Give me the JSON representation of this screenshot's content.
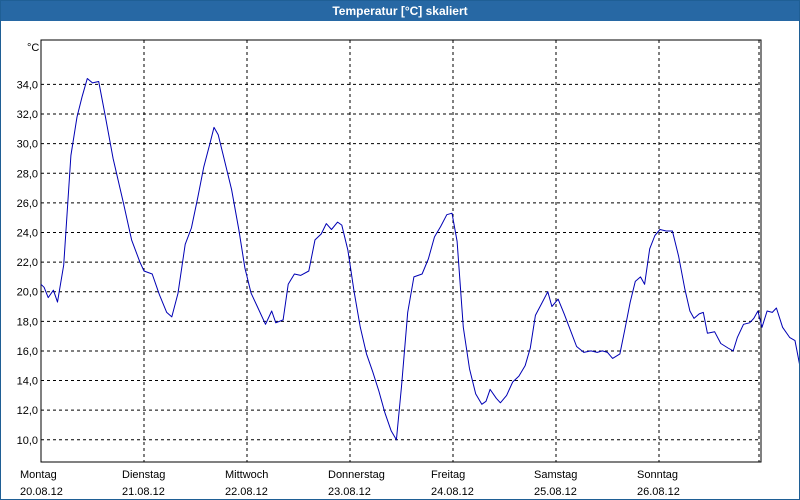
{
  "window": {
    "title": "Temperatur [°C] skaliert"
  },
  "chart_data": {
    "type": "line",
    "title": "Temperatur [°C] skaliert",
    "ylabel": "°C",
    "ylim": [
      8.5,
      37.0
    ],
    "yticks": [
      10.0,
      12.0,
      14.0,
      16.0,
      18.0,
      20.0,
      22.0,
      24.0,
      26.0,
      28.0,
      30.0,
      32.0,
      34.0
    ],
    "ytick_labels": [
      "10,0",
      "12,0",
      "14,0",
      "16,0",
      "18,0",
      "20,0",
      "22,0",
      "24,0",
      "26,0",
      "28,0",
      "30,0",
      "32,0",
      "34,0"
    ],
    "xlim": [
      0,
      7
    ],
    "xticks": [
      {
        "x": 0,
        "day": "Montag",
        "date": "20.08.12"
      },
      {
        "x": 1,
        "day": "Dienstag",
        "date": "21.08.12"
      },
      {
        "x": 2,
        "day": "Mittwoch",
        "date": "22.08.12"
      },
      {
        "x": 3,
        "day": "Donnerstag",
        "date": "23.08.12"
      },
      {
        "x": 4,
        "day": "Freitag",
        "date": "24.08.12"
      },
      {
        "x": 5,
        "day": "Samstag",
        "date": "25.08.12"
      },
      {
        "x": 6,
        "day": "Sonntag",
        "date": "26.08.12"
      }
    ],
    "grid": true,
    "color": "#0000b4",
    "series": [
      {
        "name": "",
        "points": [
          [
            0.0,
            20.5
          ],
          [
            0.03,
            20.3
          ],
          [
            0.07,
            19.6
          ],
          [
            0.12,
            20.1
          ],
          [
            0.16,
            19.3
          ],
          [
            0.22,
            21.8
          ],
          [
            0.29,
            29.2
          ],
          [
            0.35,
            31.8
          ],
          [
            0.4,
            33.2
          ],
          [
            0.45,
            34.4
          ],
          [
            0.5,
            34.1
          ],
          [
            0.56,
            34.2
          ],
          [
            0.62,
            32.0
          ],
          [
            0.7,
            29.0
          ],
          [
            0.8,
            26.0
          ],
          [
            0.88,
            23.5
          ],
          [
            0.96,
            22.0
          ],
          [
            1.0,
            21.4
          ],
          [
            1.08,
            21.2
          ],
          [
            1.15,
            19.8
          ],
          [
            1.22,
            18.6
          ],
          [
            1.27,
            18.3
          ],
          [
            1.33,
            19.9
          ],
          [
            1.4,
            23.2
          ],
          [
            1.46,
            24.3
          ],
          [
            1.52,
            26.3
          ],
          [
            1.58,
            28.4
          ],
          [
            1.64,
            30.0
          ],
          [
            1.68,
            31.1
          ],
          [
            1.72,
            30.6
          ],
          [
            1.77,
            29.2
          ],
          [
            1.85,
            26.9
          ],
          [
            1.92,
            24.2
          ],
          [
            1.98,
            21.6
          ],
          [
            2.04,
            19.9
          ],
          [
            2.1,
            19.0
          ],
          [
            2.18,
            17.8
          ],
          [
            2.24,
            18.7
          ],
          [
            2.28,
            17.9
          ],
          [
            2.35,
            18.1
          ],
          [
            2.4,
            20.5
          ],
          [
            2.46,
            21.2
          ],
          [
            2.52,
            21.1
          ],
          [
            2.6,
            21.4
          ],
          [
            2.66,
            23.5
          ],
          [
            2.72,
            23.9
          ],
          [
            2.77,
            24.6
          ],
          [
            2.82,
            24.2
          ],
          [
            2.88,
            24.7
          ],
          [
            2.92,
            24.5
          ],
          [
            2.98,
            22.8
          ],
          [
            3.04,
            20.0
          ],
          [
            3.1,
            17.6
          ],
          [
            3.16,
            15.8
          ],
          [
            3.22,
            14.6
          ],
          [
            3.28,
            13.3
          ],
          [
            3.34,
            11.8
          ],
          [
            3.4,
            10.6
          ],
          [
            3.45,
            10.0
          ],
          [
            3.5,
            13.6
          ],
          [
            3.56,
            18.6
          ],
          [
            3.62,
            21.0
          ],
          [
            3.7,
            21.2
          ],
          [
            3.76,
            22.2
          ],
          [
            3.82,
            23.7
          ],
          [
            3.88,
            24.4
          ],
          [
            3.94,
            25.2
          ],
          [
            3.99,
            25.3
          ],
          [
            4.04,
            23.4
          ],
          [
            4.1,
            17.6
          ],
          [
            4.16,
            14.8
          ],
          [
            4.22,
            13.1
          ],
          [
            4.28,
            12.4
          ],
          [
            4.32,
            12.6
          ],
          [
            4.36,
            13.4
          ],
          [
            4.42,
            12.8
          ],
          [
            4.46,
            12.5
          ],
          [
            4.52,
            13.0
          ],
          [
            4.58,
            13.9
          ],
          [
            4.64,
            14.3
          ],
          [
            4.7,
            15.0
          ],
          [
            4.75,
            16.2
          ],
          [
            4.8,
            18.4
          ],
          [
            4.86,
            19.2
          ],
          [
            4.92,
            20.0
          ],
          [
            4.96,
            19.0
          ],
          [
            5.02,
            19.5
          ],
          [
            5.08,
            18.5
          ],
          [
            5.14,
            17.4
          ],
          [
            5.2,
            16.3
          ],
          [
            5.27,
            15.9
          ],
          [
            5.34,
            16.0
          ],
          [
            5.4,
            15.9
          ],
          [
            5.45,
            16.0
          ],
          [
            5.5,
            15.9
          ],
          [
            5.55,
            15.5
          ],
          [
            5.62,
            15.8
          ],
          [
            5.67,
            17.5
          ],
          [
            5.72,
            19.3
          ],
          [
            5.77,
            20.7
          ],
          [
            5.82,
            21.0
          ],
          [
            5.86,
            20.5
          ],
          [
            5.91,
            22.9
          ],
          [
            5.96,
            23.8
          ],
          [
            6.01,
            24.2
          ],
          [
            6.07,
            24.1
          ],
          [
            6.13,
            24.1
          ],
          [
            6.19,
            22.4
          ],
          [
            6.25,
            20.2
          ],
          [
            6.3,
            18.7
          ],
          [
            6.34,
            18.2
          ],
          [
            6.39,
            18.5
          ],
          [
            6.43,
            18.6
          ],
          [
            6.47,
            17.2
          ],
          [
            6.54,
            17.3
          ],
          [
            6.6,
            16.5
          ],
          [
            6.67,
            16.2
          ],
          [
            6.72,
            16.0
          ],
          [
            6.76,
            16.9
          ],
          [
            6.82,
            17.8
          ],
          [
            6.88,
            17.9
          ],
          [
            6.92,
            18.2
          ],
          [
            6.96,
            18.7
          ],
          [
            7.0,
            17.6
          ],
          [
            7.05,
            18.7
          ],
          [
            7.1,
            18.6
          ],
          [
            7.14,
            18.9
          ],
          [
            7.2,
            17.6
          ],
          [
            7.27,
            16.9
          ],
          [
            7.32,
            16.7
          ],
          [
            7.37,
            14.9
          ],
          [
            7.42,
            14.3
          ],
          [
            7.46,
            14.2
          ],
          [
            7.52,
            14.6
          ],
          [
            7.57,
            14.8
          ]
        ]
      }
    ]
  }
}
